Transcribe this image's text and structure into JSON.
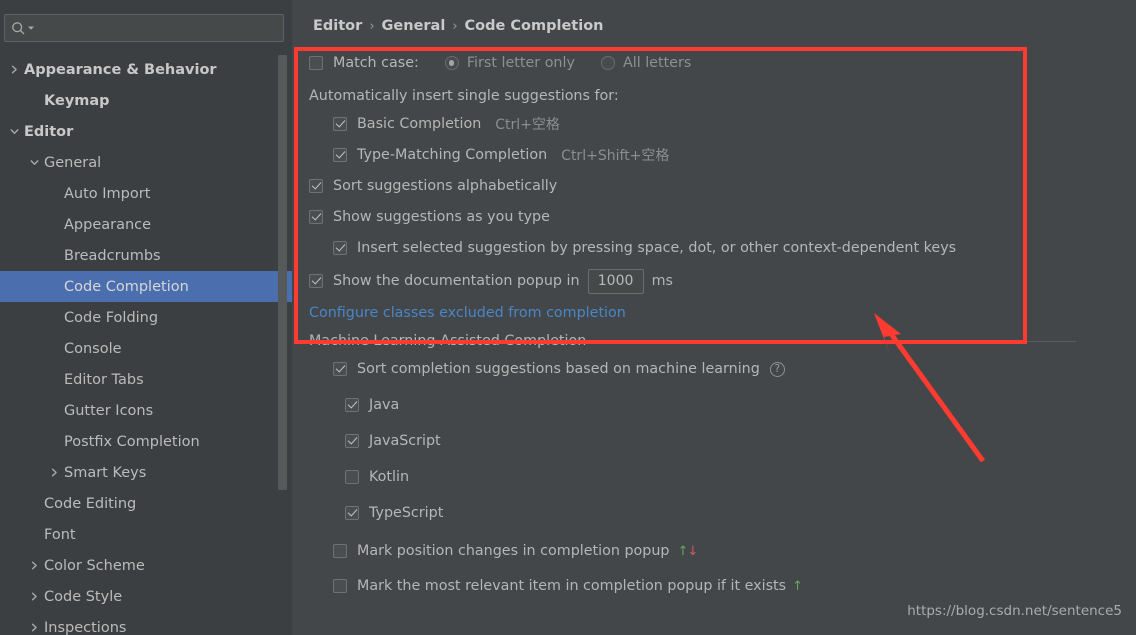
{
  "search": {
    "placeholder": "",
    "value": "",
    "icon": "search-icon"
  },
  "sidebar": {
    "items": [
      {
        "label": "Appearance & Behavior",
        "indent": 0,
        "twisty": "chevron-right",
        "bold": true,
        "selected": false
      },
      {
        "label": "Keymap",
        "indent": 1,
        "twisty": "none",
        "bold": true,
        "selected": false
      },
      {
        "label": "Editor",
        "indent": 0,
        "twisty": "chevron-down",
        "bold": true,
        "selected": false
      },
      {
        "label": "General",
        "indent": 1,
        "twisty": "chevron-down",
        "bold": false,
        "selected": false
      },
      {
        "label": "Auto Import",
        "indent": 2,
        "twisty": "none",
        "bold": false,
        "selected": false
      },
      {
        "label": "Appearance",
        "indent": 2,
        "twisty": "none",
        "bold": false,
        "selected": false
      },
      {
        "label": "Breadcrumbs",
        "indent": 2,
        "twisty": "none",
        "bold": false,
        "selected": false
      },
      {
        "label": "Code Completion",
        "indent": 2,
        "twisty": "none",
        "bold": false,
        "selected": true
      },
      {
        "label": "Code Folding",
        "indent": 2,
        "twisty": "none",
        "bold": false,
        "selected": false
      },
      {
        "label": "Console",
        "indent": 2,
        "twisty": "none",
        "bold": false,
        "selected": false
      },
      {
        "label": "Editor Tabs",
        "indent": 2,
        "twisty": "none",
        "bold": false,
        "selected": false
      },
      {
        "label": "Gutter Icons",
        "indent": 2,
        "twisty": "none",
        "bold": false,
        "selected": false
      },
      {
        "label": "Postfix Completion",
        "indent": 2,
        "twisty": "none",
        "bold": false,
        "selected": false
      },
      {
        "label": "Smart Keys",
        "indent": 2,
        "twisty": "chevron-right",
        "bold": false,
        "selected": false
      },
      {
        "label": "Code Editing",
        "indent": 1,
        "twisty": "none",
        "bold": false,
        "selected": false
      },
      {
        "label": "Font",
        "indent": 1,
        "twisty": "none",
        "bold": false,
        "selected": false
      },
      {
        "label": "Color Scheme",
        "indent": 1,
        "twisty": "chevron-right",
        "bold": false,
        "selected": false
      },
      {
        "label": "Code Style",
        "indent": 1,
        "twisty": "chevron-right",
        "bold": false,
        "selected": false
      },
      {
        "label": "Inspections",
        "indent": 1,
        "twisty": "chevron-right",
        "bold": false,
        "selected": false
      }
    ]
  },
  "breadcrumb": {
    "level1": "Editor",
    "sep1": "›",
    "level2": "General",
    "sep2": "›",
    "level3": "Code Completion"
  },
  "settings": {
    "match_case": {
      "label": "Match case:",
      "checked": false,
      "options": [
        {
          "label": "First letter only",
          "selected": true
        },
        {
          "label": "All letters",
          "selected": false
        }
      ]
    },
    "auto_insert_header": "Automatically insert single suggestions for:",
    "auto_insert_items": [
      {
        "label": "Basic Completion",
        "shortcut": "Ctrl+空格",
        "checked": true
      },
      {
        "label": "Type-Matching Completion",
        "shortcut": "Ctrl+Shift+空格",
        "checked": true
      }
    ],
    "sort_alphabetically": {
      "label": "Sort suggestions alphabetically",
      "checked": true
    },
    "show_as_you_type": {
      "label": "Show suggestions as you type",
      "checked": true
    },
    "insert_selected": {
      "label": "Insert selected suggestion by pressing space, dot, or other context-dependent keys",
      "checked": true
    },
    "doc_popup": {
      "label": "Show the documentation popup in",
      "checked": true,
      "delay": "1000",
      "unit": "ms"
    },
    "excluded_link": "Configure classes excluded from completion"
  },
  "ml_section": {
    "title": "Machine Learning-Assisted Completion",
    "sort_ml": {
      "label": "Sort completion suggestions based on machine learning",
      "checked": true,
      "help_icon": "question-mark-icon",
      "help_glyph": "?"
    },
    "languages": [
      {
        "label": "Java",
        "checked": true
      },
      {
        "label": "JavaScript",
        "checked": true
      },
      {
        "label": "Kotlin",
        "checked": false
      },
      {
        "label": "TypeScript",
        "checked": true
      }
    ],
    "mark_position": {
      "label": "Mark position changes in completion popup",
      "checked": false,
      "up_glyph": "↑",
      "down_glyph": "↓"
    },
    "mark_relevant": {
      "label": "Mark the most relevant item in completion popup if it exists",
      "checked": false,
      "up_glyph": "↑"
    }
  },
  "annotations": {
    "highlight_color": "#fd3b30",
    "arrow_color": "#fd3b30",
    "watermark": "https://blog.csdn.net/sentence5"
  },
  "colors": {
    "bg": "#3c3f41",
    "main_bg": "#434749",
    "selection": "#4b6eaf",
    "link": "#4a86c7",
    "text": "#b5b5b5",
    "arrow_up": "#62a95c",
    "arrow_down": "#d05c5c"
  }
}
